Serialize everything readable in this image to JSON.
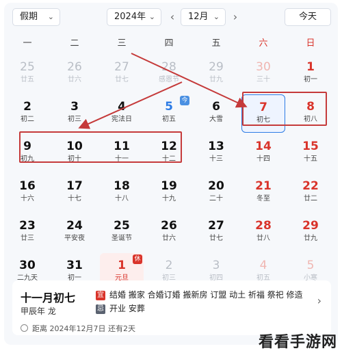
{
  "toolbar": {
    "holiday_select": "假期",
    "year_select": "2024年",
    "prev_label": "‹",
    "month_select": "12月",
    "next_label": "›",
    "today_button": "今天",
    "chevron": "⌄"
  },
  "weekdays": [
    "一",
    "二",
    "三",
    "四",
    "五",
    "六",
    "日"
  ],
  "rows": [
    [
      {
        "day": "25",
        "lunar": "廿五",
        "other": true
      },
      {
        "day": "26",
        "lunar": "廿六",
        "other": true
      },
      {
        "day": "27",
        "lunar": "廿七",
        "other": true
      },
      {
        "day": "28",
        "lunar": "感恩节",
        "other": true
      },
      {
        "day": "29",
        "lunar": "廿九",
        "other": true
      },
      {
        "day": "30",
        "lunar": "三十",
        "other": true
      },
      {
        "day": "1",
        "lunar": "初一"
      }
    ],
    [
      {
        "day": "2",
        "lunar": "初二"
      },
      {
        "day": "3",
        "lunar": "初三"
      },
      {
        "day": "4",
        "lunar": "宪法日"
      },
      {
        "day": "5",
        "lunar": "初五",
        "tag": "今"
      },
      {
        "day": "6",
        "lunar": "大雪"
      },
      {
        "day": "7",
        "lunar": "初七"
      },
      {
        "day": "8",
        "lunar": "初八"
      }
    ],
    [
      {
        "day": "9",
        "lunar": "初九"
      },
      {
        "day": "10",
        "lunar": "初十"
      },
      {
        "day": "11",
        "lunar": "十一"
      },
      {
        "day": "12",
        "lunar": "十二"
      },
      {
        "day": "13",
        "lunar": "十三"
      },
      {
        "day": "14",
        "lunar": "十四"
      },
      {
        "day": "15",
        "lunar": "十五"
      }
    ],
    [
      {
        "day": "16",
        "lunar": "十六"
      },
      {
        "day": "17",
        "lunar": "十七"
      },
      {
        "day": "18",
        "lunar": "十八"
      },
      {
        "day": "19",
        "lunar": "十九"
      },
      {
        "day": "20",
        "lunar": "二十"
      },
      {
        "day": "21",
        "lunar": "冬至"
      },
      {
        "day": "22",
        "lunar": "廿二"
      }
    ],
    [
      {
        "day": "23",
        "lunar": "廿三"
      },
      {
        "day": "24",
        "lunar": "平安夜"
      },
      {
        "day": "25",
        "lunar": "圣诞节"
      },
      {
        "day": "26",
        "lunar": "廿六"
      },
      {
        "day": "27",
        "lunar": "廿七"
      },
      {
        "day": "28",
        "lunar": "廿八"
      },
      {
        "day": "29",
        "lunar": "廿九"
      }
    ],
    [
      {
        "day": "30",
        "lunar": "二九天"
      },
      {
        "day": "31",
        "lunar": "初一"
      },
      {
        "day": "1",
        "lunar": "元旦",
        "other": true,
        "tag": "休"
      },
      {
        "day": "2",
        "lunar": "初三",
        "other": true
      },
      {
        "day": "3",
        "lunar": "初四",
        "other": true
      },
      {
        "day": "4",
        "lunar": "初五",
        "other": true
      },
      {
        "day": "5",
        "lunar": "小寒",
        "other": true
      }
    ]
  ],
  "info": {
    "lunar_date": "十一月初七",
    "ganzhi": "甲辰年 龙",
    "yi_badge": "宜",
    "yi_text": "结婚 搬家 合婚订婚 搬新房 订盟 动土 祈福 祭祀 修造",
    "ji_badge": "忌",
    "ji_text": "开业 安葬",
    "countdown": "距离 2024年12月7日 还有2天",
    "chevron": "›"
  },
  "watermark": "看看手游网",
  "colors": {
    "accent": "#2c7be5",
    "weekend_red": "#d9342b",
    "annotation_red": "#c53a3a"
  }
}
